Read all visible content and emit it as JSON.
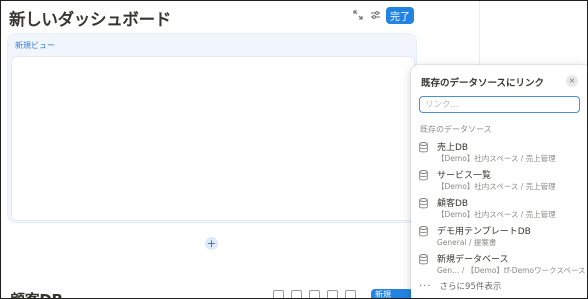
{
  "header": {
    "title": "新しいダッシュボード",
    "done_label": "完了",
    "icons": [
      "expand-icon",
      "settings-sliders-icon"
    ]
  },
  "view": {
    "label": "新規ビュー",
    "add_icon": "+"
  },
  "bottom": {
    "title": "顧客DB",
    "button_label": "新規"
  },
  "popover": {
    "title": "既存のデータソースにリンク",
    "close_icon": "×",
    "search_placeholder": "リンク...",
    "search_value": "",
    "section_label": "既存のデータソース",
    "sources": [
      {
        "name": "売上DB",
        "path": "【Demo】社内スペース / 売上管理"
      },
      {
        "name": "サービス一覧",
        "path": "【Demo】社内スペース / 売上管理"
      },
      {
        "name": "顧客DB",
        "path": "【Demo】社内スペース / 売上管理"
      },
      {
        "name": "デモ用テンプレートDB",
        "path": "General / 提案書"
      },
      {
        "name": "新規データベース",
        "path": "Gen... / 【Demo】tf-Demoワークスペース"
      }
    ],
    "more_label": "さらに95件表示",
    "more_icon": "···"
  }
}
